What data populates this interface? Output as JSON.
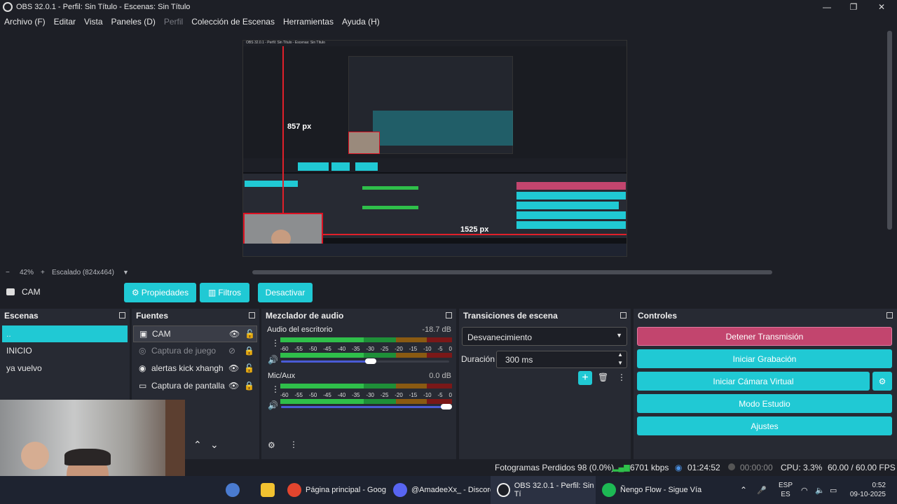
{
  "window": {
    "title": "OBS 32.0.1 - Perfil: Sin Título - Escenas: Sin Título",
    "minimize": "—",
    "maximize": "❐",
    "close": "✕"
  },
  "menu": [
    "Archivo (F)",
    "Editar",
    "Vista",
    "Paneles (D)",
    "Perfil",
    "Colección de Escenas",
    "Herramientas",
    "Ayuda (H)"
  ],
  "menu_disabled": "Perfil",
  "preview": {
    "inner_title": "OBS 32.0.1 - Perfil: Sin Título - Escenas: Sin Título",
    "measure_vertical": "857 px",
    "measure_horizontal": "1525 px"
  },
  "zoom": {
    "minus": "−",
    "percent": "42%",
    "plus": "+",
    "scaling": "Escalado (824x464)"
  },
  "source_toolbar": {
    "source_name": "CAM",
    "properties": "Propiedades",
    "filters": "Filtros",
    "deactivate": "Desactivar"
  },
  "scenes": {
    "title": "Escenas",
    "items": [
      "..",
      "INICIO",
      "ya vuelvo"
    ]
  },
  "sources": {
    "title": "Fuentes",
    "items": [
      {
        "name": "CAM",
        "icon": "camera-icon"
      },
      {
        "name": "Captura de juego",
        "icon": "gamepad-icon"
      },
      {
        "name": "alertas kick xhangh",
        "icon": "globe-icon"
      },
      {
        "name": "Captura de pantalla",
        "icon": "monitor-icon"
      }
    ]
  },
  "mixer": {
    "title": "Mezclador de audio",
    "channels": [
      {
        "name": "Audio del escritorio",
        "db": "-18.7 dB",
        "volume": 0.55
      },
      {
        "name": "Mic/Aux",
        "db": "0.0 dB",
        "volume": 1.0
      }
    ],
    "scale": [
      "-60",
      "-55",
      "-50",
      "-45",
      "-40",
      "-35",
      "-30",
      "-25",
      "-20",
      "-15",
      "-10",
      "-5",
      "0"
    ]
  },
  "transitions": {
    "title": "Transiciones de escena",
    "selected": "Desvanecimiento",
    "duration_label": "Duración",
    "duration_value": "300 ms"
  },
  "controls": {
    "title": "Controles",
    "stop_stream": "Detener Transmisión",
    "start_recording": "Iniciar Grabación",
    "start_virtual_cam": "Iniciar Cámara Virtual",
    "studio_mode": "Modo Estudio",
    "settings": "Ajustes"
  },
  "status": {
    "dropped_frames": "Fotogramas Perdidos 98 (0.0%)",
    "bitrate": "6701 kbps",
    "stream_time": "01:24:52",
    "rec_time": "00:00:00",
    "cpu": "CPU: 3.3%",
    "fps": "60.00 / 60.00 FPS"
  },
  "taskbar": {
    "items": [
      {
        "label": "Página principal - Goog",
        "icon": "chrome-icon"
      },
      {
        "label": "@AmadeeXx_ - Discord",
        "icon": "discord-icon"
      },
      {
        "label": "OBS 32.0.1 - Perfil: Sin Tí",
        "icon": "obs-icon"
      },
      {
        "label": "Ñengo Flow - Sigue Vía",
        "icon": "spotify-icon"
      }
    ],
    "lang_top": "ESP",
    "lang_bottom": "ES",
    "time": "0:52",
    "date": "09-10-2025"
  },
  "colors": {
    "accent": "#20c9d4",
    "stop_stream": "#c2456e",
    "panel": "#272a33",
    "background": "#1d1f26"
  }
}
